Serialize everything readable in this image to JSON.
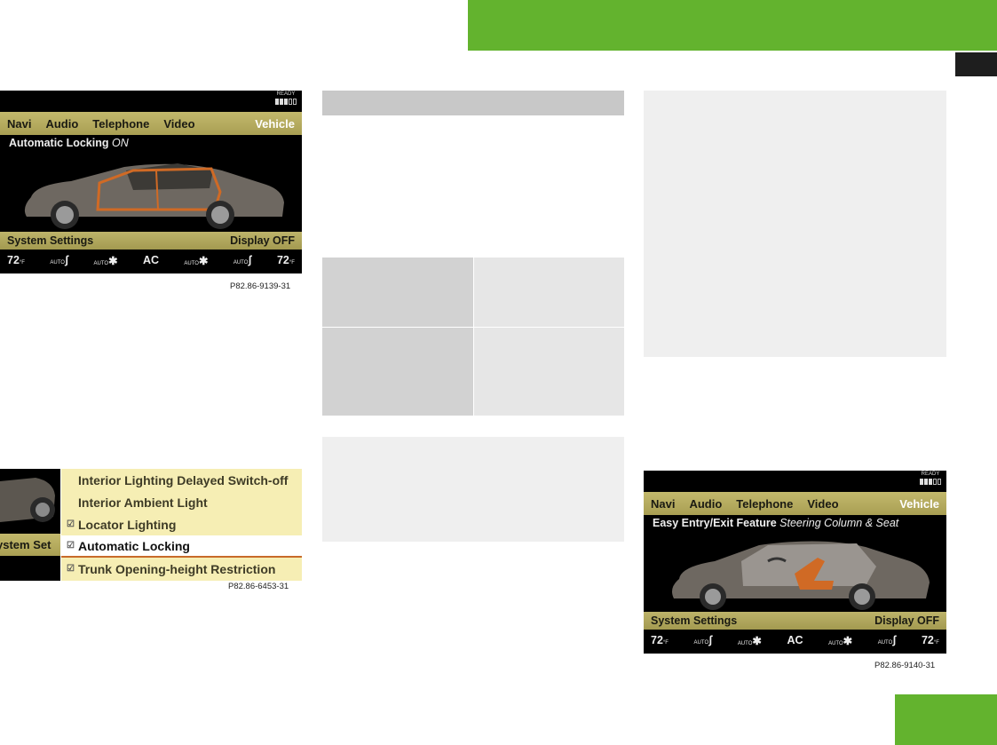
{
  "screen1": {
    "ready_label": "READY",
    "menu": [
      "Navi",
      "Audio",
      "Telephone",
      "Video",
      "Vehicle"
    ],
    "title_bold": "Automatic Locking",
    "title_italic": "ON",
    "system_settings": "System Settings",
    "display_off": "Display OFF",
    "climate": {
      "temp_left": "72",
      "unit": "°F",
      "auto_vent": "AUTO",
      "auto_fan": "AUTO",
      "ac": "AC",
      "temp_right": "72"
    },
    "caption": "P82.86-9139-31"
  },
  "screen2": {
    "sys_tab": "ystem Set",
    "items": [
      {
        "label": "Interior Lighting Delayed Switch-off",
        "checked": false
      },
      {
        "label": "Interior Ambient Light",
        "checked": false
      },
      {
        "label": "Locator Lighting",
        "checked": true
      },
      {
        "label": "Automatic Locking",
        "checked": true,
        "selected": true
      },
      {
        "label": "Trunk Opening-height Restriction",
        "checked": true
      }
    ],
    "check_glyph": "☑",
    "caption": "P82.86-6453-31"
  },
  "screen3": {
    "ready_label": "READY",
    "menu": [
      "Navi",
      "Audio",
      "Telephone",
      "Video",
      "Vehicle"
    ],
    "title_bold": "Easy Entry/Exit Feature",
    "title_italic": "Steering Column & Seat",
    "system_settings": "System Settings",
    "display_off": "Display OFF",
    "climate": {
      "temp_left": "72",
      "unit": "°F",
      "auto_vent": "AUTO",
      "auto_fan": "AUTO",
      "ac": "AC",
      "temp_right": "72"
    },
    "caption": "P82.86-9140-31"
  },
  "colors": {
    "accent_green": "#63b32e",
    "menu_gold": "#b5ab5e",
    "list_bg": "#f6eeb4",
    "highlight": "#c86a2a"
  }
}
